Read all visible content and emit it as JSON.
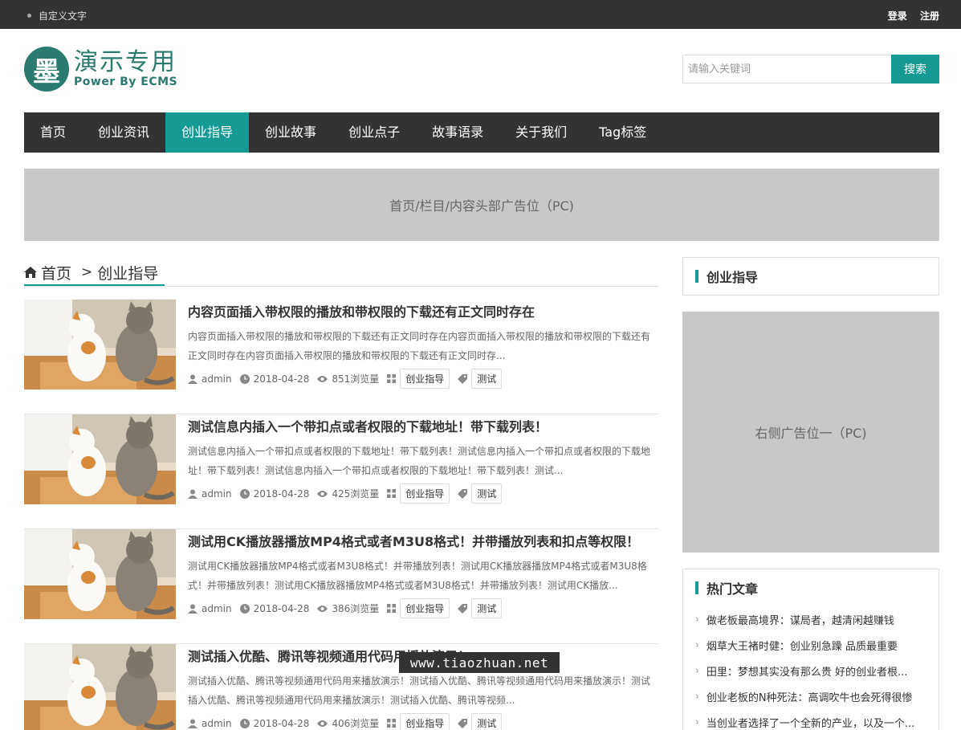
{
  "topbar": {
    "custom_text": "自定义文字",
    "login": "登录",
    "register": "注册"
  },
  "logo": {
    "mark": "墨",
    "title": "演示专用",
    "subtitle": "Power By ECMS"
  },
  "search": {
    "placeholder": "请输入关键词",
    "button": "搜索"
  },
  "nav": {
    "items": [
      "首页",
      "创业资讯",
      "创业指导",
      "创业故事",
      "创业点子",
      "故事语录",
      "关于我们",
      "Tag标签"
    ],
    "active": "创业指导"
  },
  "banner": {
    "text": "首页/栏目/内容头部广告位（PC)"
  },
  "breadcrumb": {
    "home": "首页",
    "separator": ">",
    "current": "创业指导"
  },
  "articles": [
    {
      "title": "内容页面插入带权限的播放和带权限的下载还有正文同时存在",
      "desc": "内容页面插入带权限的播放和带权限的下载还有正文同时存在内容页面插入带权限的播放和带权限的下载还有正文同时存在内容页面插入带权限的播放和带权限的下载还有正文同时存...",
      "author": "admin",
      "date": "2018-04-28",
      "views": "851浏览量",
      "category": "创业指导",
      "tag": "测试"
    },
    {
      "title": "测试信息内插入一个带扣点或者权限的下载地址！带下载列表！",
      "desc": "测试信息内插入一个带扣点或者权限的下载地址！带下载列表！测试信息内插入一个带扣点或者权限的下载地址！带下载列表！测试信息内插入一个带扣点或者权限的下载地址！带下载列表！测试...",
      "author": "admin",
      "date": "2018-04-28",
      "views": "425浏览量",
      "category": "创业指导",
      "tag": "测试"
    },
    {
      "title": "测试用CK播放器播放MP4格式或者M3U8格式！并带播放列表和扣点等权限！",
      "desc": "测试用CK播放器播放MP4格式或者M3U8格式！并带播放列表！测试用CK播放器播放MP4格式或者M3U8格式！并带播放列表！测试用CK播放器播放MP4格式或者M3U8格式！并带播放列表！测试用CK播放...",
      "author": "admin",
      "date": "2018-04-28",
      "views": "386浏览量",
      "category": "创业指导",
      "tag": "测试"
    },
    {
      "title": "测试插入优酷、腾讯等视频通用代码用播放演示！",
      "desc": "测试插入优酷、腾讯等视频通用代码用来播放演示！测试插入优酷、腾讯等视频通用代码用来播放演示！测试插入优酷、腾讯等视频通用代码用来播放演示！测试插入优酷、腾讯等视频...",
      "author": "admin",
      "date": "2018-04-28",
      "views": "406浏览量",
      "category": "创业指导",
      "tag": "测试"
    }
  ],
  "sidebar": {
    "category_title": "创业指导",
    "ad_text": "右侧广告位一（PC)",
    "hot_title": "热门文章",
    "hot_items": [
      "做老板最高境界：谋局者，越清闲越赚钱",
      "烟草大王褚时健：创业别急躁 品质最重要",
      "田里：梦想其实没有那么贵 好的创业者根...",
      "创业老板的N种死法：高调吹牛也会死得很惨",
      "当创业者选择了一个全新的产业，以及一个..."
    ]
  },
  "watermark": "www.tiaozhuan.net",
  "colors": {
    "accent": "#169a94",
    "dark": "#333333",
    "ad_gray": "#c8c8c8",
    "logo_green": "#2a7a70"
  }
}
